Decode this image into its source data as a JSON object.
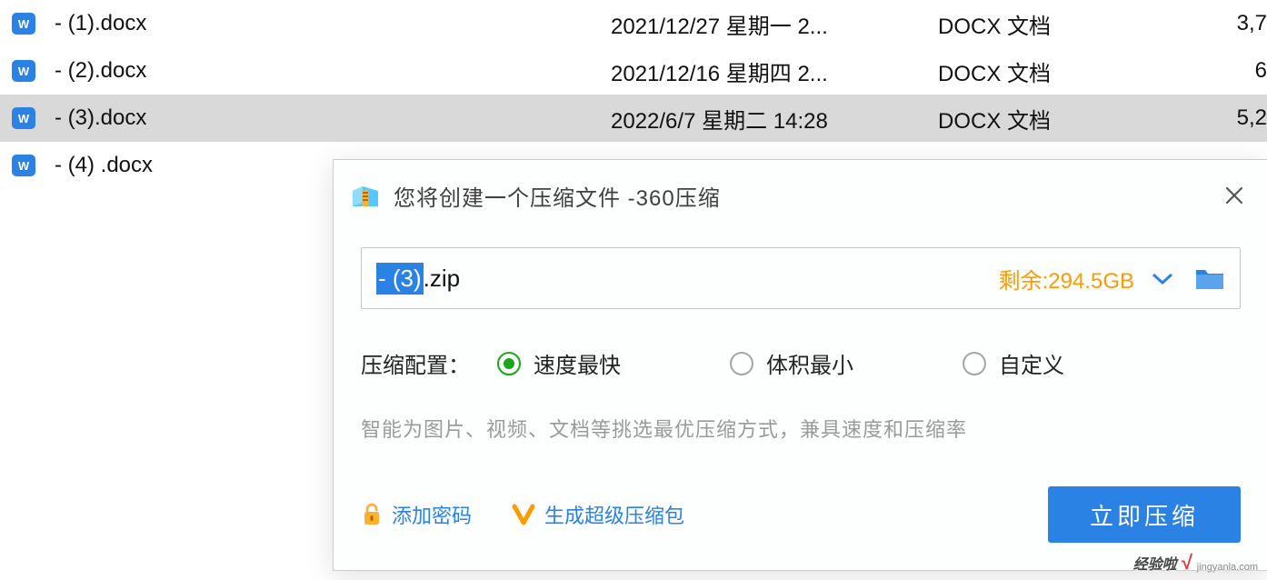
{
  "files": [
    {
      "name": "- (1).docx",
      "date": "2021/12/27 星期一 2...",
      "type": "DOCX 文档",
      "size": "3,7",
      "selected": false
    },
    {
      "name": "- (2).docx",
      "date": "2021/12/16 星期四 2...",
      "type": "DOCX 文档",
      "size": "6",
      "selected": false
    },
    {
      "name": "- (3).docx",
      "date": "2022/6/7 星期二 14:28",
      "type": "DOCX 文档",
      "size": "5,2",
      "selected": true
    },
    {
      "name": "- (4) .docx",
      "date": "",
      "type": "",
      "size": "",
      "selected": false
    }
  ],
  "dialog": {
    "title": "您将创建一个压缩文件 -360压缩",
    "filename_selected": "- (3)",
    "filename_ext": ".zip",
    "remaining": "剩余:294.5GB",
    "config_label": "压缩配置：",
    "options": {
      "fast": "速度最快",
      "small": "体积最小",
      "custom": "自定义"
    },
    "hint": "智能为图片、视频、文档等挑选最优压缩方式，兼具速度和压缩率",
    "add_password": "添加密码",
    "super_pack": "生成超级压缩包",
    "compress_btn": "立即压缩"
  },
  "watermark": {
    "main": "经验啦",
    "sub": "jingyanla.com"
  }
}
